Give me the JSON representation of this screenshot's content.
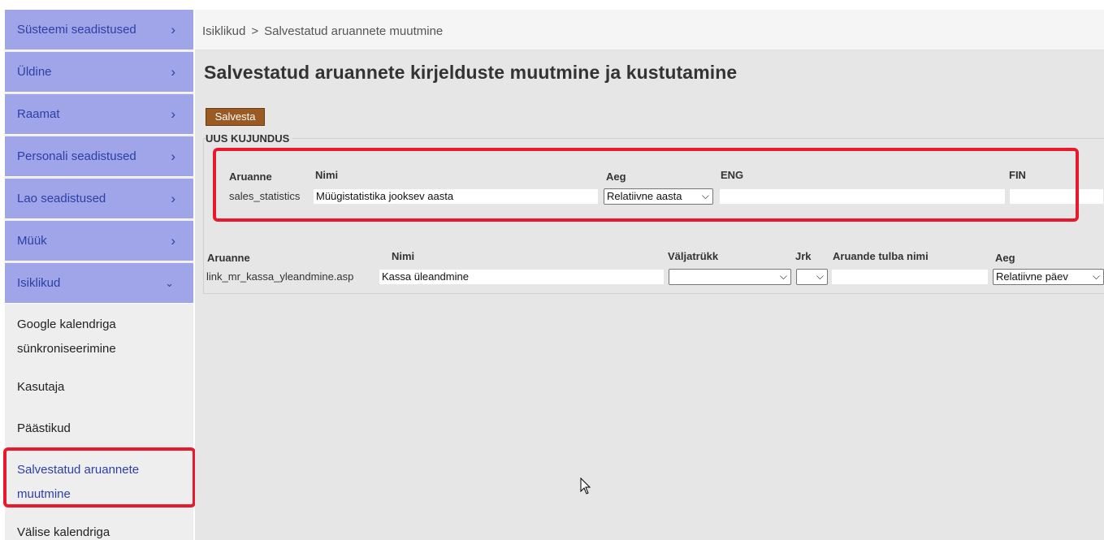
{
  "sidebar": {
    "top_items": [
      {
        "label": "Süsteemi seadistused",
        "chevron": "›"
      },
      {
        "label": "Üldine",
        "chevron": "›"
      },
      {
        "label": "Raamat",
        "chevron": "›"
      },
      {
        "label": "Personali seadistused",
        "chevron": "›"
      },
      {
        "label": "Lao seadistused",
        "chevron": "›"
      },
      {
        "label": "Müük",
        "chevron": "›"
      },
      {
        "label": "Isiklikud",
        "chevron": "⌄"
      }
    ],
    "sub_items": [
      {
        "label_line1": "Google kalendriga",
        "label_line2": "sünkroniseerimine"
      },
      {
        "label_line1": "Kasutaja"
      },
      {
        "label_line1": "Päästikud"
      },
      {
        "label_line1": "Salvestatud aruannete",
        "label_line2": "muutmine"
      },
      {
        "label_line1": "Välise kalendriga"
      }
    ]
  },
  "breadcrumb": {
    "parent": "Isiklikud",
    "separator": ">",
    "current": "Salvestatud aruannete muutmine"
  },
  "page": {
    "title": "Salvestatud aruannete kirjelduste muutmine ja kustutamine",
    "save_label": "Salvesta"
  },
  "new_layout": {
    "legend": "UUS KUJUNDUS",
    "headers": {
      "report": "Aruanne",
      "name": "Nimi",
      "time": "Aeg",
      "eng": "ENG",
      "fin": "FIN"
    },
    "row": {
      "report": "sales_statistics",
      "name": "Müügistatistika jooksev aasta",
      "time": "Relatiivne aasta",
      "eng": "",
      "fin": ""
    }
  },
  "reports_table": {
    "headers": {
      "report": "Aruanne",
      "name": "Nimi",
      "printout": "Väljatrükk",
      "order": "Jrk",
      "column_name": "Aruande tulba nimi",
      "time": "Aeg"
    },
    "row": {
      "report": "link_mr_kassa_yleandmine.asp",
      "name": "Kassa üleandmine",
      "printout": "",
      "order": "",
      "column_name": "",
      "time": "Relatiivne päev"
    }
  },
  "colors": {
    "sidebar_item_bg": "#9fa5e8",
    "sidebar_text": "#2d3fa6",
    "save_button": "#9b5a24",
    "highlight": "#e8192c"
  }
}
